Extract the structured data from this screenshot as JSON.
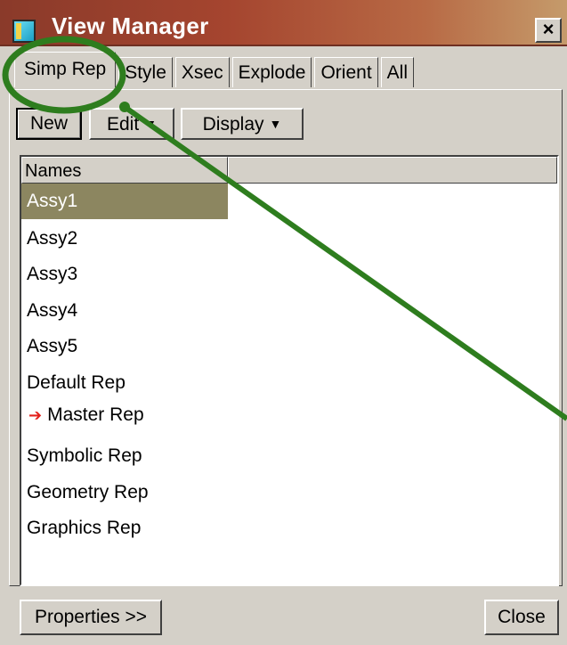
{
  "window": {
    "title": "View Manager",
    "close_glyph": "×"
  },
  "tabs": [
    "Simp Rep",
    "Style",
    "Xsec",
    "Explode",
    "Orient",
    "All"
  ],
  "toolbar": {
    "new_label": "New",
    "edit_label": "Edit",
    "display_label": "Display"
  },
  "list": {
    "columns": [
      "Names",
      ""
    ],
    "rows": [
      "Assy1",
      "Assy2",
      "Assy3",
      "Assy4",
      "Assy5",
      "Default Rep",
      "Master Rep",
      "Symbolic Rep",
      "Geometry Rep",
      "Graphics Rep"
    ],
    "selected_index": 0,
    "active_index": 6
  },
  "footer": {
    "properties_label": "Properties >>",
    "close_label": "Close"
  },
  "colors": {
    "selection": "#8c8660",
    "annotation": "#2e7d1e",
    "active_marker": "#e3201b"
  },
  "icons": {
    "app": "view-manager-icon",
    "active_marker": "red-arrow-icon",
    "dropdown": "caret-down-icon"
  }
}
